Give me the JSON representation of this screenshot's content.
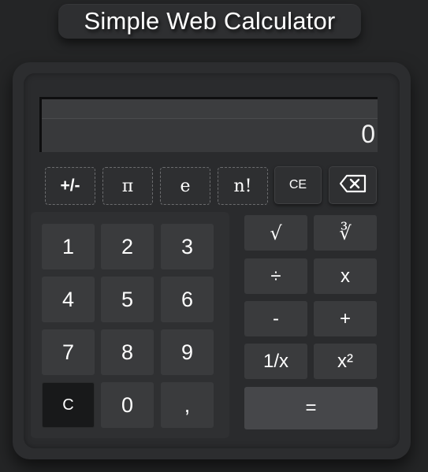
{
  "header": {
    "title": "Simple Web Calculator"
  },
  "display": {
    "value": "0"
  },
  "functions": {
    "plus_minus": "+/-",
    "pi": "π",
    "e": "e",
    "factorial": "n!",
    "clear_entry": "CE",
    "backspace_icon": "backspace-icon"
  },
  "numpad": {
    "k1": "1",
    "k2": "2",
    "k3": "3",
    "k4": "4",
    "k5": "5",
    "k6": "6",
    "k7": "7",
    "k8": "8",
    "k9": "9",
    "clear": "C",
    "k0": "0",
    "decimal": ","
  },
  "operators": {
    "sqrt": "√",
    "cbrt": "∛",
    "divide": "÷",
    "multiply": "x",
    "subtract": "-",
    "add": "+",
    "reciprocal": "1/x",
    "square": "x²",
    "equals": "="
  },
  "colors": {
    "page_bg": "#242526",
    "panel_bg": "#2c2d2f",
    "key_bg": "#3a3b3d",
    "clear_key_bg": "#18191a",
    "equals_bg": "#46474a",
    "text": "#ffffff"
  }
}
